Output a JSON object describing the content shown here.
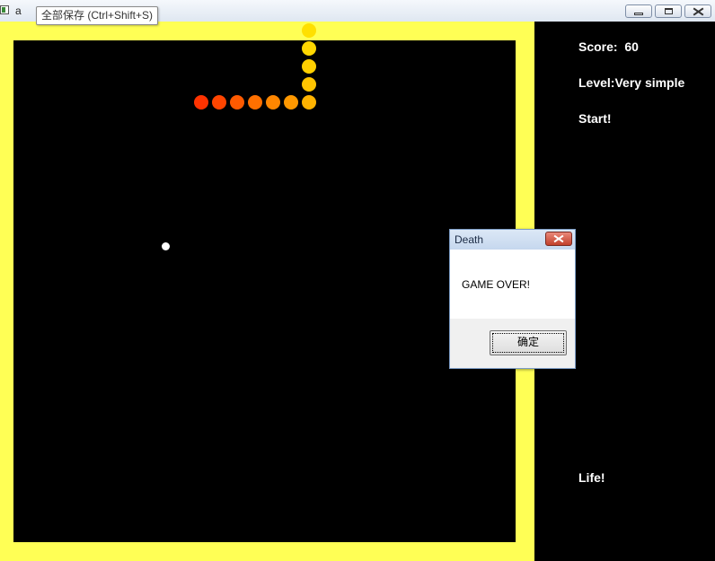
{
  "window": {
    "title": "a"
  },
  "tooltip": {
    "text": "全部保存 (Ctrl+Shift+S)"
  },
  "colors": {
    "border": "#ffff55",
    "field": "#000000",
    "food": "#ffffff",
    "panel_text": "#ffffff"
  },
  "panel": {
    "score_label": "Score:  60",
    "level_label": "Level:Very simple",
    "start_label": "Start!",
    "life_label": "Life!"
  },
  "dialog": {
    "title": "Death",
    "message": "GAME OVER!",
    "ok_label": "确定"
  },
  "snake": [
    {
      "color": "#ffe000"
    },
    {
      "color": "#ffd700"
    },
    {
      "color": "#ffcf00"
    },
    {
      "color": "#ffc400"
    },
    {
      "color": "#ffb300"
    },
    {
      "color": "#ff9800"
    },
    {
      "color": "#ff8600"
    },
    {
      "color": "#ff7000"
    },
    {
      "color": "#ff5a00"
    },
    {
      "color": "#ff4500"
    },
    {
      "color": "#ff3300"
    }
  ]
}
